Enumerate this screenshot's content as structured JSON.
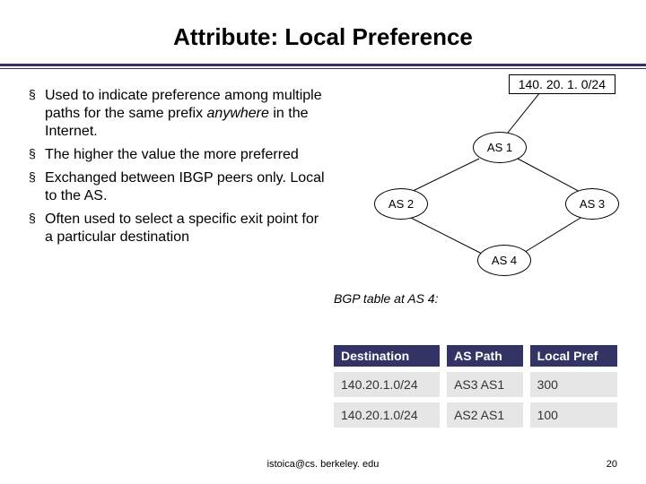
{
  "title": "Attribute: Local Preference",
  "prefix": "140. 20. 1. 0/24",
  "bullets": [
    {
      "pre": "Used to indicate preference among multiple paths for the same prefix ",
      "em": "anywhere",
      "post": " in the Internet."
    },
    {
      "pre": "The higher the value the more preferred",
      "em": "",
      "post": ""
    },
    {
      "pre": "Exchanged between IBGP peers only. Local to the AS.",
      "em": "",
      "post": ""
    },
    {
      "pre": "Often used to select a specific exit point for a particular destination",
      "em": "",
      "post": ""
    }
  ],
  "nodes": {
    "as1": "AS 1",
    "as2": "AS 2",
    "as3": "AS 3",
    "as4": "AS 4"
  },
  "bgp_caption": "BGP table at AS 4:",
  "table": {
    "headers": [
      "Destination",
      "AS Path",
      "Local Pref"
    ],
    "rows": [
      [
        "140.20.1.0/24",
        "AS3  AS1",
        "300"
      ],
      [
        "140.20.1.0/24",
        "AS2  AS1",
        "100"
      ]
    ]
  },
  "footer": {
    "email": "istoica@cs. berkeley. edu",
    "page": "20"
  }
}
